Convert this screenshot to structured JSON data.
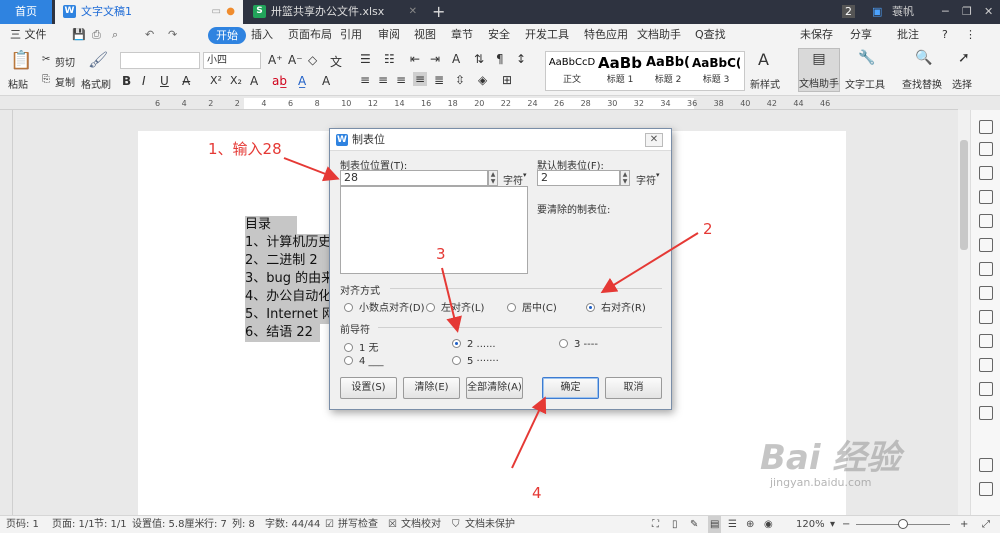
{
  "tabs": {
    "home": "首页",
    "doc": "文字文稿1",
    "xlsx": "卅篮共享办公文件.xlsx",
    "page_count": "2",
    "user": "蓑帆"
  },
  "menu": {
    "file": "三 文件",
    "items": [
      "开始",
      "插入",
      "页面布局",
      "引用",
      "审阅",
      "视图",
      "章节",
      "安全",
      "开发工具",
      "特色应用",
      "文档助手",
      "Q查找"
    ],
    "unsaved": "未保存",
    "share": "分享",
    "comment": "批注"
  },
  "ribbon": {
    "paste": "粘贴",
    "cut": "剪切",
    "copy": "复制",
    "format_painter": "格式刷",
    "font_size": "小四",
    "styles": [
      {
        "preview": "AaBbCcD",
        "name": "正文"
      },
      {
        "preview": "AaBb",
        "name": "标题 1"
      },
      {
        "preview": "AaBb(",
        "name": "标题 2"
      },
      {
        "preview": "AaBbC(",
        "name": "标题 3"
      }
    ],
    "new_style": "新样式",
    "doc_assistant": "文档助手",
    "text_tools": "文字工具",
    "find_replace": "查找替换",
    "select": "选择"
  },
  "ruler": {
    "marks": [
      "6",
      "4",
      "2",
      "2",
      "4",
      "6",
      "8",
      "10",
      "12",
      "14",
      "16",
      "18",
      "20",
      "22",
      "24",
      "26",
      "28",
      "30",
      "32",
      "34",
      "36",
      "38",
      "40",
      "42",
      "44",
      "46"
    ]
  },
  "document": {
    "lines": [
      "目录",
      "1、计算机历史",
      "2、二进制 2",
      "3、bug 的由来",
      "4、办公自动化",
      "5、Internet 网",
      "6、结语 22"
    ]
  },
  "dialog": {
    "title": "制表位",
    "tab_position_label": "制表位位置(T):",
    "tab_position_value": "28",
    "unit": "字符",
    "default_tab_label": "默认制表位(F):",
    "default_tab_value": "2",
    "to_clear_label": "要清除的制表位:",
    "alignment_label": "对齐方式",
    "alignment_options": [
      "小数点对齐(D)",
      "左对齐(L)",
      "居中(C)",
      "右对齐(R)"
    ],
    "leader_label": "前导符",
    "leader_options": [
      "1 无",
      "2 ......",
      "3 ----",
      "4 ___",
      "5 ·······"
    ],
    "buttons": {
      "set": "设置(S)",
      "clear": "清除(E)",
      "clear_all": "全部清除(A)",
      "ok": "确定",
      "cancel": "取消"
    }
  },
  "annotations": {
    "step1": "1、输入28",
    "step2": "2",
    "step3": "3",
    "step4": "4",
    "color": "#e53935"
  },
  "statusbar": {
    "page_num": "页码: 1",
    "pages": "页面: 1/1",
    "section": "节: 1/1",
    "position": "设置值: 5.8厘米",
    "row": "行: 7",
    "col": "列: 8",
    "words": "字数: 44/44",
    "spell": "拼写检查",
    "proof": "文档校对",
    "protect": "文档未保护",
    "zoom": "120%"
  },
  "watermark": {
    "text": "Bai 经验",
    "url": "jingyan.baidu.com"
  }
}
